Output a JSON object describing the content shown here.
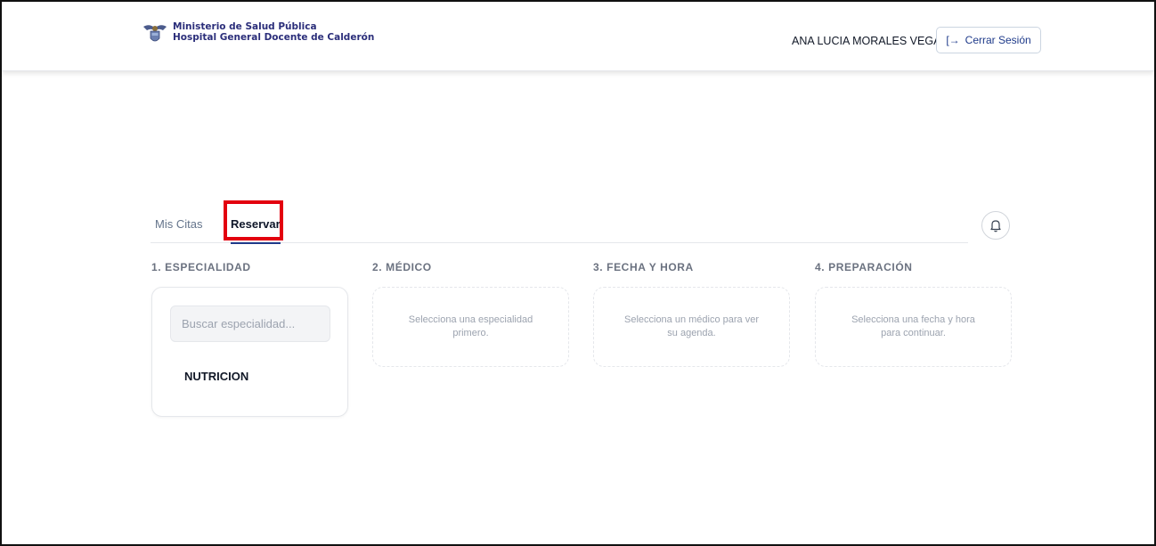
{
  "header": {
    "org_line1": "Ministerio de Salud Pública",
    "org_line2": "Hospital General Docente de Calderón",
    "user_name": "ANA LUCIA MORALES VEGA",
    "logout_label": "Cerrar Sesión",
    "logout_icon": "logout-icon"
  },
  "tabs": [
    {
      "label": "Mis Citas",
      "active": false
    },
    {
      "label": "Reservar",
      "active": true
    }
  ],
  "steps": [
    {
      "title": "1. ESPECIALIDAD",
      "search_placeholder": "Buscar especialidad...",
      "items": [
        "NUTRICION"
      ]
    },
    {
      "title": "2. MÉDICO",
      "message": "Selecciona una especialidad primero."
    },
    {
      "title": "3. FECHA Y HORA",
      "message": "Selecciona un médico para ver su agenda."
    },
    {
      "title": "4. PREPARACIÓN",
      "message": "Selecciona una fecha y hora para continuar."
    }
  ],
  "colors": {
    "brand": "#2b2e7a",
    "accent": "#1e3a8a",
    "highlight": "#e3000f"
  }
}
